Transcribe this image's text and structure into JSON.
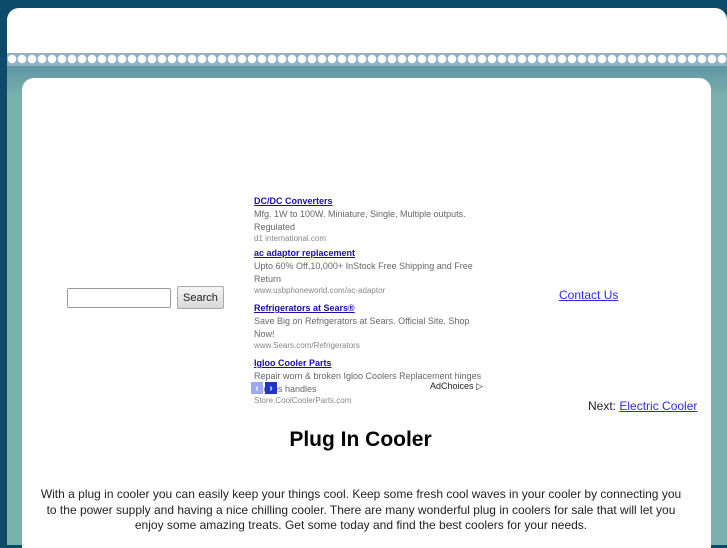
{
  "search": {
    "placeholder": "",
    "value": "",
    "button_label": "Search"
  },
  "ads": [
    {
      "title": "DC/DC Converters",
      "description": "Mfg. 1W to 100W. Miniature, Single, Multiple outputs. Regulated",
      "url": "d1 international.com"
    },
    {
      "title": "ac adaptor replacement",
      "description": "Upto 60% Off,10,000+ InStock Free Shipping and Free Return",
      "url": "www.usbphoneworld.com/ac-adaptor"
    },
    {
      "title": "Refrigerators at Sears®",
      "description": "Save Big on Refrigerators at Sears. Official Site. Shop Now!",
      "url": "www.Sears.com/Refrigerators"
    },
    {
      "title": "Igloo Cooler Parts",
      "description": "Repair worn & broken Igloo Coolers Replacement hinges latches handles",
      "url": "Store.CoolCoolerParts.com"
    }
  ],
  "ad_nav": {
    "prev_icon": "‹",
    "next_icon": "›",
    "adchoices_label": "AdChoices ▷"
  },
  "contact_link": "Contact Us",
  "next_nav": {
    "label": "Next:",
    "link": "Electric Cooler"
  },
  "article": {
    "title": "Plug In Cooler",
    "body": "With a plug in cooler you can easily keep your things cool. Keep some fresh cool waves in your cooler by connecting you to the power supply and having a nice chilling cooler. There are many wonderful plug in coolers for sale that will let you enjoy some amazing treats. Get some today and find the best coolers for your needs."
  }
}
